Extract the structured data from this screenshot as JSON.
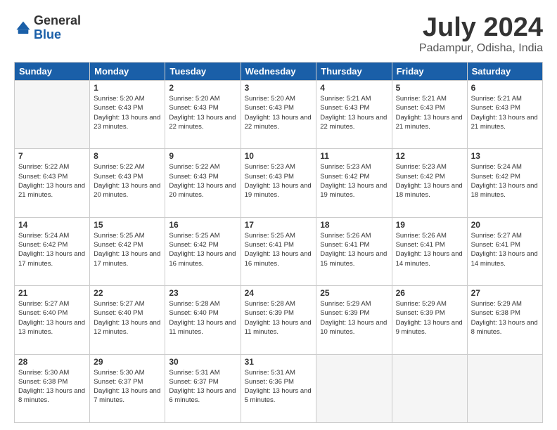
{
  "logo": {
    "general": "General",
    "blue": "Blue"
  },
  "header": {
    "month": "July 2024",
    "location": "Padampur, Odisha, India"
  },
  "weekdays": [
    "Sunday",
    "Monday",
    "Tuesday",
    "Wednesday",
    "Thursday",
    "Friday",
    "Saturday"
  ],
  "weeks": [
    [
      {
        "day": "",
        "empty": true
      },
      {
        "day": "1",
        "sunrise": "Sunrise: 5:20 AM",
        "sunset": "Sunset: 6:43 PM",
        "daylight": "Daylight: 13 hours and 23 minutes."
      },
      {
        "day": "2",
        "sunrise": "Sunrise: 5:20 AM",
        "sunset": "Sunset: 6:43 PM",
        "daylight": "Daylight: 13 hours and 22 minutes."
      },
      {
        "day": "3",
        "sunrise": "Sunrise: 5:20 AM",
        "sunset": "Sunset: 6:43 PM",
        "daylight": "Daylight: 13 hours and 22 minutes."
      },
      {
        "day": "4",
        "sunrise": "Sunrise: 5:21 AM",
        "sunset": "Sunset: 6:43 PM",
        "daylight": "Daylight: 13 hours and 22 minutes."
      },
      {
        "day": "5",
        "sunrise": "Sunrise: 5:21 AM",
        "sunset": "Sunset: 6:43 PM",
        "daylight": "Daylight: 13 hours and 21 minutes."
      },
      {
        "day": "6",
        "sunrise": "Sunrise: 5:21 AM",
        "sunset": "Sunset: 6:43 PM",
        "daylight": "Daylight: 13 hours and 21 minutes."
      }
    ],
    [
      {
        "day": "7",
        "sunrise": "Sunrise: 5:22 AM",
        "sunset": "Sunset: 6:43 PM",
        "daylight": "Daylight: 13 hours and 21 minutes."
      },
      {
        "day": "8",
        "sunrise": "Sunrise: 5:22 AM",
        "sunset": "Sunset: 6:43 PM",
        "daylight": "Daylight: 13 hours and 20 minutes."
      },
      {
        "day": "9",
        "sunrise": "Sunrise: 5:22 AM",
        "sunset": "Sunset: 6:43 PM",
        "daylight": "Daylight: 13 hours and 20 minutes."
      },
      {
        "day": "10",
        "sunrise": "Sunrise: 5:23 AM",
        "sunset": "Sunset: 6:43 PM",
        "daylight": "Daylight: 13 hours and 19 minutes."
      },
      {
        "day": "11",
        "sunrise": "Sunrise: 5:23 AM",
        "sunset": "Sunset: 6:42 PM",
        "daylight": "Daylight: 13 hours and 19 minutes."
      },
      {
        "day": "12",
        "sunrise": "Sunrise: 5:23 AM",
        "sunset": "Sunset: 6:42 PM",
        "daylight": "Daylight: 13 hours and 18 minutes."
      },
      {
        "day": "13",
        "sunrise": "Sunrise: 5:24 AM",
        "sunset": "Sunset: 6:42 PM",
        "daylight": "Daylight: 13 hours and 18 minutes."
      }
    ],
    [
      {
        "day": "14",
        "sunrise": "Sunrise: 5:24 AM",
        "sunset": "Sunset: 6:42 PM",
        "daylight": "Daylight: 13 hours and 17 minutes."
      },
      {
        "day": "15",
        "sunrise": "Sunrise: 5:25 AM",
        "sunset": "Sunset: 6:42 PM",
        "daylight": "Daylight: 13 hours and 17 minutes."
      },
      {
        "day": "16",
        "sunrise": "Sunrise: 5:25 AM",
        "sunset": "Sunset: 6:42 PM",
        "daylight": "Daylight: 13 hours and 16 minutes."
      },
      {
        "day": "17",
        "sunrise": "Sunrise: 5:25 AM",
        "sunset": "Sunset: 6:41 PM",
        "daylight": "Daylight: 13 hours and 16 minutes."
      },
      {
        "day": "18",
        "sunrise": "Sunrise: 5:26 AM",
        "sunset": "Sunset: 6:41 PM",
        "daylight": "Daylight: 13 hours and 15 minutes."
      },
      {
        "day": "19",
        "sunrise": "Sunrise: 5:26 AM",
        "sunset": "Sunset: 6:41 PM",
        "daylight": "Daylight: 13 hours and 14 minutes."
      },
      {
        "day": "20",
        "sunrise": "Sunrise: 5:27 AM",
        "sunset": "Sunset: 6:41 PM",
        "daylight": "Daylight: 13 hours and 14 minutes."
      }
    ],
    [
      {
        "day": "21",
        "sunrise": "Sunrise: 5:27 AM",
        "sunset": "Sunset: 6:40 PM",
        "daylight": "Daylight: 13 hours and 13 minutes."
      },
      {
        "day": "22",
        "sunrise": "Sunrise: 5:27 AM",
        "sunset": "Sunset: 6:40 PM",
        "daylight": "Daylight: 13 hours and 12 minutes."
      },
      {
        "day": "23",
        "sunrise": "Sunrise: 5:28 AM",
        "sunset": "Sunset: 6:40 PM",
        "daylight": "Daylight: 13 hours and 11 minutes."
      },
      {
        "day": "24",
        "sunrise": "Sunrise: 5:28 AM",
        "sunset": "Sunset: 6:39 PM",
        "daylight": "Daylight: 13 hours and 11 minutes."
      },
      {
        "day": "25",
        "sunrise": "Sunrise: 5:29 AM",
        "sunset": "Sunset: 6:39 PM",
        "daylight": "Daylight: 13 hours and 10 minutes."
      },
      {
        "day": "26",
        "sunrise": "Sunrise: 5:29 AM",
        "sunset": "Sunset: 6:39 PM",
        "daylight": "Daylight: 13 hours and 9 minutes."
      },
      {
        "day": "27",
        "sunrise": "Sunrise: 5:29 AM",
        "sunset": "Sunset: 6:38 PM",
        "daylight": "Daylight: 13 hours and 8 minutes."
      }
    ],
    [
      {
        "day": "28",
        "sunrise": "Sunrise: 5:30 AM",
        "sunset": "Sunset: 6:38 PM",
        "daylight": "Daylight: 13 hours and 8 minutes."
      },
      {
        "day": "29",
        "sunrise": "Sunrise: 5:30 AM",
        "sunset": "Sunset: 6:37 PM",
        "daylight": "Daylight: 13 hours and 7 minutes."
      },
      {
        "day": "30",
        "sunrise": "Sunrise: 5:31 AM",
        "sunset": "Sunset: 6:37 PM",
        "daylight": "Daylight: 13 hours and 6 minutes."
      },
      {
        "day": "31",
        "sunrise": "Sunrise: 5:31 AM",
        "sunset": "Sunset: 6:36 PM",
        "daylight": "Daylight: 13 hours and 5 minutes."
      },
      {
        "day": "",
        "empty": true
      },
      {
        "day": "",
        "empty": true
      },
      {
        "day": "",
        "empty": true
      }
    ]
  ]
}
